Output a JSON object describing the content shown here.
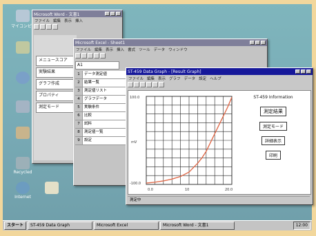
{
  "desktop": {
    "icons": [
      {
        "label": "マイコンピュータ",
        "color": "#b7c8d6"
      },
      {
        "label": "",
        "color": "#c0c8a0"
      },
      {
        "label": "",
        "color": "#7aa0c8"
      },
      {
        "label": "",
        "color": "#a4b4c4"
      },
      {
        "label": "",
        "color": "#c8b48c"
      },
      {
        "label": "Recycled",
        "color": "#9cb0b8"
      },
      {
        "label": "Internet",
        "color": "#6c9cc0"
      }
    ]
  },
  "colors": {
    "titlebar_active": "#16189a",
    "titlebar_inactive": "#7f7f9a",
    "plot_line": "#e06a4a"
  },
  "word": {
    "title": "Microsoft Word - 文書1",
    "menu": [
      "ファイル",
      "編集",
      "表示",
      "挿入",
      "書式",
      "ツール",
      "罫線",
      "ウィンドウ"
    ],
    "list": [
      "メニュースコア",
      "実験結果",
      "グラフ作成",
      "プロパティ",
      "測定モード"
    ]
  },
  "excel": {
    "title": "Microsoft Excel - Sheet1",
    "menu": [
      "ファイル",
      "編集",
      "表示",
      "挿入",
      "書式",
      "ツール",
      "データ",
      "ウィンドウ"
    ],
    "namebox": "A1",
    "rows": [
      "データ測定値",
      "結果一覧",
      "測定値リスト",
      "グラフデータ",
      "実験条件",
      "比較",
      "試料",
      "測定値一覧",
      "設定"
    ]
  },
  "graph": {
    "title": "ST-459 Data Graph - [Result Graph]",
    "menu": [
      "ファイル",
      "編集",
      "表示",
      "グラフ",
      "データ",
      "設定",
      "ヘルプ"
    ],
    "info_title": "ST-459 Information",
    "btn_result": "測定結果",
    "btn_mode": "測定モード",
    "btn_info": "詳細表示",
    "btn_print": "印刷",
    "y_top": "100.0",
    "y_bottom": "-100.0",
    "y_label": "mV",
    "x_ticks": [
      "0.0",
      "10",
      "20.0"
    ],
    "status": "測定中"
  },
  "chart_data": {
    "type": "line",
    "title": "",
    "xlabel": "",
    "ylabel": "mV",
    "xlim": [
      0,
      20
    ],
    "ylim": [
      -100,
      100
    ],
    "grid": true,
    "series": [
      {
        "x": [
          0,
          2,
          4,
          6,
          8,
          10,
          11,
          12,
          13,
          14,
          15,
          16,
          17,
          18,
          19,
          20
        ],
        "y": [
          -97,
          -95,
          -92,
          -88,
          -82,
          -72,
          -62,
          -52,
          -40,
          -25,
          -5,
          15,
          35,
          55,
          75,
          98
        ]
      }
    ]
  },
  "taskbar": {
    "start": "スタート",
    "tasks": [
      "ST-459 Data Graph",
      "Microsoft Excel",
      "Microsoft Word - 文書1"
    ],
    "clock": "12:00"
  }
}
